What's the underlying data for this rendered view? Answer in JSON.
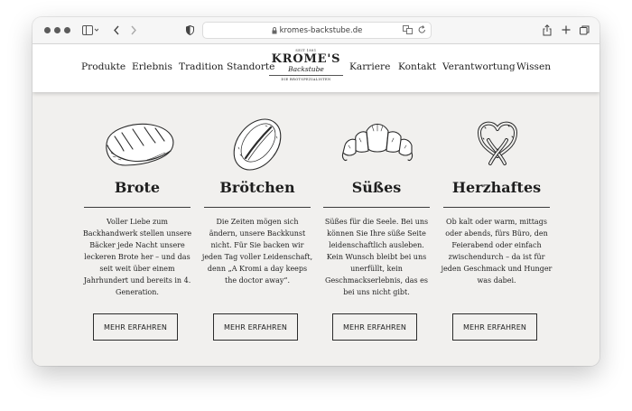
{
  "browser": {
    "url": "kromes-backstube.de"
  },
  "nav": {
    "left": [
      "Produkte",
      "Erlebnis",
      "Tradition",
      "Standorte"
    ],
    "right": [
      "Karriere",
      "Kontakt",
      "Verantwortung",
      "Wissen"
    ]
  },
  "logo": {
    "est": "SEIT 1881",
    "brand": "KROME'S",
    "script": "Backstube",
    "tagline": "DIE BROTSPEZIALISTEN"
  },
  "categories": [
    {
      "title": "Brote",
      "icon": "bread-loaf-icon",
      "description": "Voller Liebe zum Backhandwerk stellen unsere Bäcker jede Nacht unsere leckeren Brote her – und das seit weit über einem Jahrhundert und bereits in 4. Generation.",
      "button": "MEHR ERFAHREN"
    },
    {
      "title": "Brötchen",
      "icon": "bread-roll-icon",
      "description": "Die Zeiten mögen sich ändern, unsere Backkunst nicht. Für Sie backen wir jeden Tag voller Leidenschaft, denn „A Kromi a day keeps the doctor away“.",
      "button": "MEHR ERFAHREN"
    },
    {
      "title": "Süßes",
      "icon": "croissant-icon",
      "description": "Süßes für die Seele. Bei uns können Sie Ihre süße Seite leidenschaftlich ausleben. Kein Wunsch bleibt bei uns unerfüllt, kein Geschmackserlebnis, das es bei uns nicht gibt.",
      "button": "MEHR ERFAHREN"
    },
    {
      "title": "Herzhaftes",
      "icon": "pretzel-icon",
      "description": "Ob kalt oder warm, mittags oder abends, fürs Büro, den Feierabend oder einfach zwischendurch – da ist für jeden Geschmack und Hunger was dabei.",
      "button": "MEHR ERFAHREN"
    }
  ]
}
